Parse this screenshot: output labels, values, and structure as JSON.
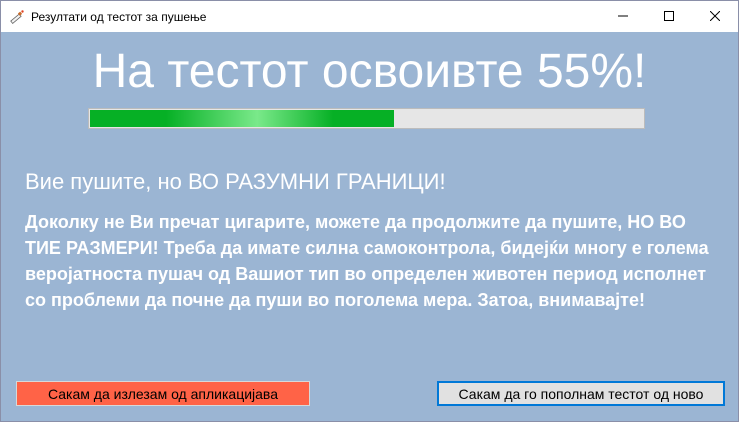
{
  "window": {
    "title": "Резултати од тестот за пушење",
    "app_icon": "smoking-cigarette-icon",
    "controls": [
      "minimize-icon",
      "maximize-icon",
      "close-icon"
    ]
  },
  "result": {
    "headline": "На тестот освоивте 55%!",
    "score_percent": 55,
    "verdict": "Вие пушите, но ВО РАЗУМНИ ГРАНИЦИ!",
    "description": "Доколку не Ви пречат цигарите, можете да продолжите да пушите, НО ВО ТИЕ РАЗМЕРИ! Треба да имате силна самоконтрола, бидејќи многу е голема веројатноста пушач од Вашиот тип во определен животен период исполнет со проблеми да почне да пуши во поголема мера. Затоа, внимавајте!"
  },
  "buttons": {
    "exit_label": "Сакам да излезам од апликацијава",
    "retry_label": "Сакам да го пополнам тестот од ново"
  },
  "colors": {
    "background": "#9bb5d3",
    "progress_fill": "#06b025",
    "exit_button": "#ff6347",
    "focus_border": "#0078d7"
  }
}
